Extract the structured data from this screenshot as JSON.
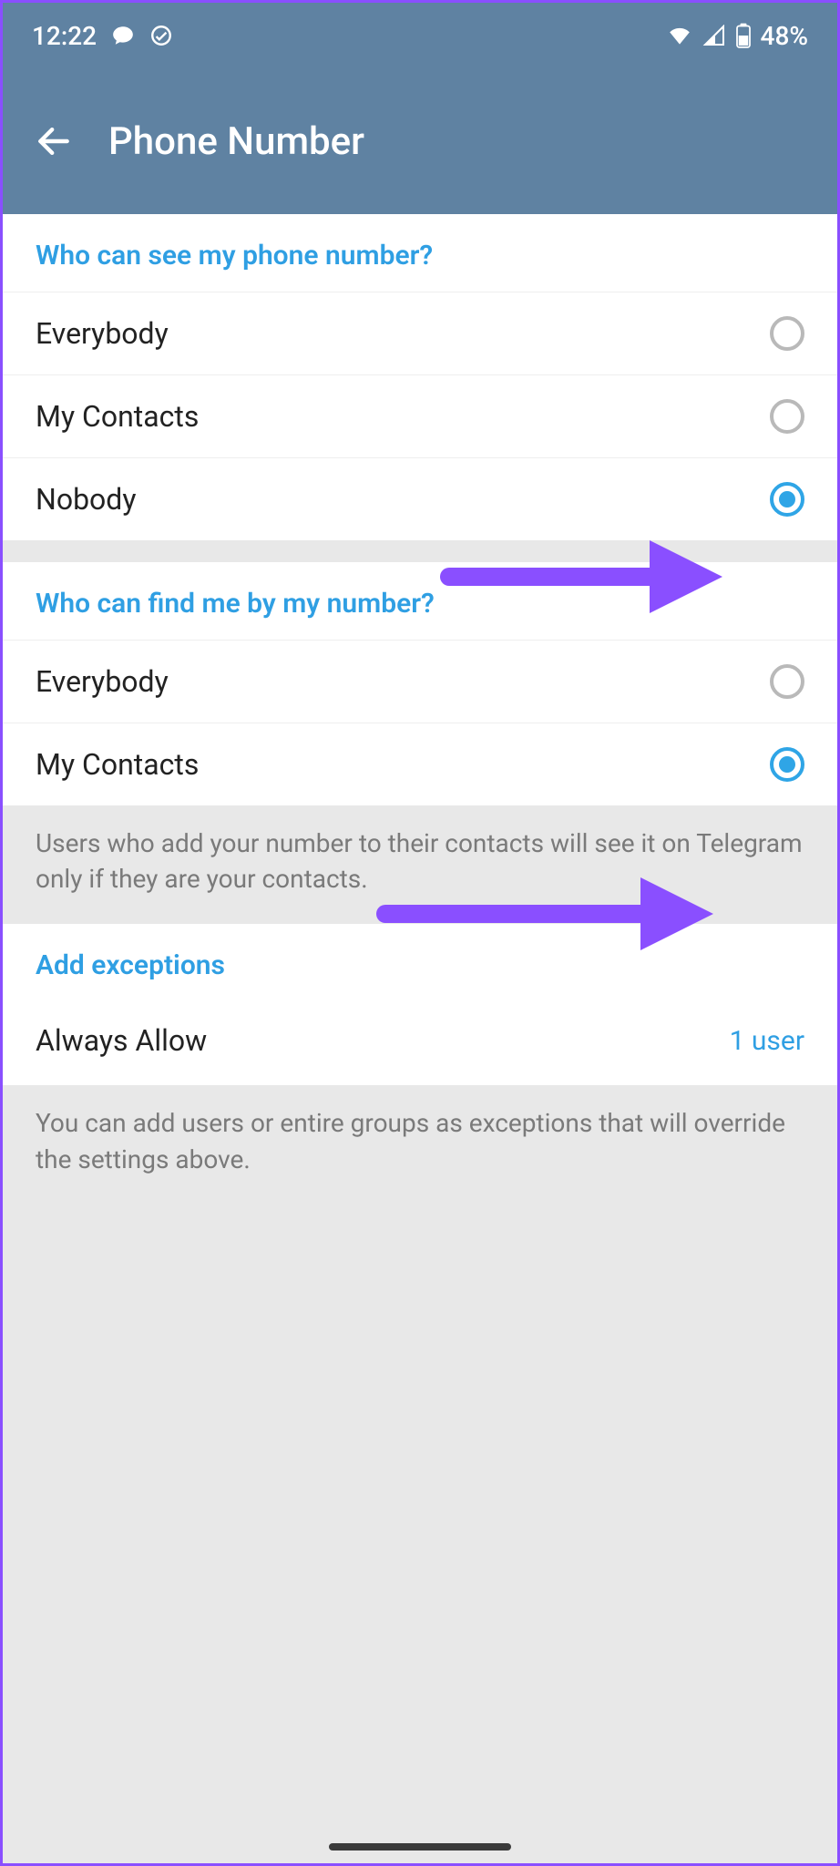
{
  "status": {
    "time": "12:22",
    "battery_text": "48%"
  },
  "header": {
    "title": "Phone Number"
  },
  "section_see": {
    "title": "Who can see my phone number?",
    "options": [
      {
        "label": "Everybody",
        "selected": false
      },
      {
        "label": "My Contacts",
        "selected": false
      },
      {
        "label": "Nobody",
        "selected": true
      }
    ]
  },
  "section_find": {
    "title": "Who can find me by my number?",
    "options": [
      {
        "label": "Everybody",
        "selected": false
      },
      {
        "label": "My Contacts",
        "selected": true
      }
    ],
    "footer": "Users who add your number to their contacts will see it on Telegram only if they are your contacts."
  },
  "section_exceptions": {
    "title": "Add exceptions",
    "rows": [
      {
        "label": "Always Allow",
        "value": "1 user"
      }
    ],
    "footer": "You can add users or entire groups as exceptions that will override the settings above."
  },
  "colors": {
    "accent": "#2f9fe3",
    "header_bg": "#5f82a2",
    "annotation": "#8a4fff"
  }
}
